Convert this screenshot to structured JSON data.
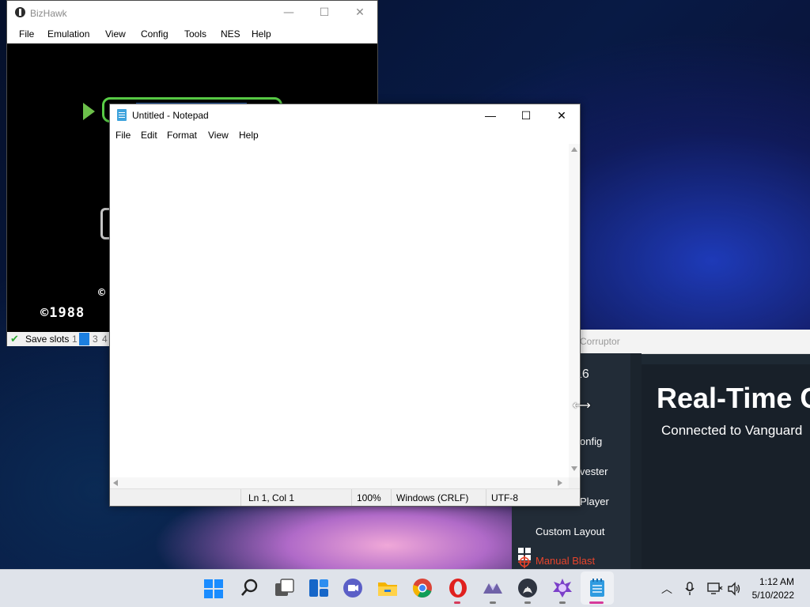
{
  "rtc_window": {
    "title": "Corruptor",
    "version_fragment": "16",
    "heading": "Real-Time C",
    "subheading": "Connected to Vanguard",
    "sidebar_items": [
      "onfig",
      "vester",
      "Player",
      "Custom Layout",
      "Manual Blast"
    ],
    "accent_color": "#e8442b"
  },
  "bizhawk": {
    "title": "BizHawk",
    "menu": [
      "File",
      "Emulation",
      "View",
      "Config",
      "Tools",
      "NES",
      "Help"
    ],
    "status": {
      "label": "Save slots",
      "slots": [
        "1",
        "2",
        "3",
        "4"
      ],
      "active_slot": "2"
    },
    "game": {
      "copyright": "©1988",
      "copyright_fragment": "©"
    }
  },
  "notepad": {
    "title": "Untitled - Notepad",
    "menu": [
      "File",
      "Edit",
      "Format",
      "View",
      "Help"
    ],
    "content": "",
    "status": {
      "position": "Ln 1, Col 1",
      "zoom": "100%",
      "line_endings": "Windows (CRLF)",
      "encoding": "UTF-8"
    }
  },
  "window_controls": {
    "minimize": "—",
    "maximize": "☐",
    "close": "✕"
  },
  "taskbar": {
    "apps": [
      "start-icon",
      "search-icon",
      "task-view-icon",
      "widgets-icon",
      "teams-chat-icon",
      "file-explorer-icon",
      "chrome-icon",
      "opera-icon",
      "vanguard-icon",
      "spectre-icon",
      "rtc-icon",
      "notepad-icon"
    ],
    "clock": {
      "time": "1:12 AM",
      "date": "5/10/2022"
    }
  }
}
